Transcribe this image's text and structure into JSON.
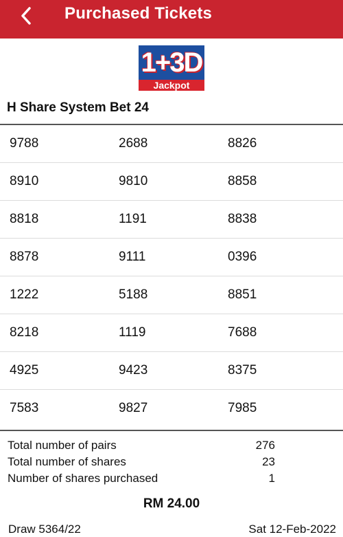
{
  "header": {
    "title": "Purchased Tickets",
    "back_icon": "chevron-left-icon",
    "color": "#c9242f"
  },
  "logo": {
    "main_text": "1+3D",
    "sub_text": "Jackpot",
    "colors": {
      "blue": "#1d4fa0",
      "red": "#d9252e"
    }
  },
  "bet": {
    "title": "H Share System Bet 24"
  },
  "numbers": [
    [
      "9788",
      "2688",
      "8826"
    ],
    [
      "8910",
      "9810",
      "8858"
    ],
    [
      "8818",
      "1191",
      "8838"
    ],
    [
      "8878",
      "9111",
      "0396"
    ],
    [
      "1222",
      "5188",
      "8851"
    ],
    [
      "8218",
      "1119",
      "7688"
    ],
    [
      "4925",
      "9423",
      "8375"
    ],
    [
      "7583",
      "9827",
      "7985"
    ]
  ],
  "summary": [
    {
      "label": "Total number of pairs",
      "value": "276"
    },
    {
      "label": "Total number of shares",
      "value": "23"
    },
    {
      "label": "Number of shares purchased",
      "value": "1"
    }
  ],
  "total": "RM 24.00",
  "footer": {
    "draw": "Draw 5364/22",
    "date": "Sat 12-Feb-2022"
  }
}
